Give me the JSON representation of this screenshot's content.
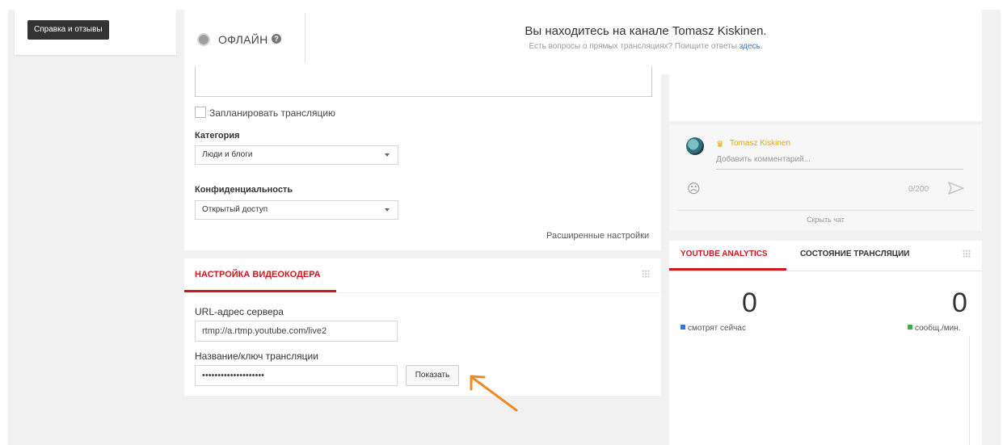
{
  "help": {
    "label": "Справка и отзывы"
  },
  "status": {
    "label": "ОФЛАЙН",
    "help_icon": "?"
  },
  "channel": {
    "title": "Вы находитесь на канале Tomasz Kiskinen.",
    "subtitle": "Есть вопросы о прямых трансляциях? Поищите ответы",
    "link": "здесь."
  },
  "settings": {
    "schedule_label": "Запланировать трансляцию",
    "category_label": "Категория",
    "category_value": "Люди и блоги",
    "privacy_label": "Конфиденциальность",
    "privacy_value": "Открытый доступ",
    "advanced_link": "Расширенные настройки"
  },
  "encoder": {
    "tab_label": "НАСТРОЙКА ВИДЕОКОДЕРА",
    "server_label": "URL-адрес сервера",
    "server_value": "rtmp://a.rtmp.youtube.com/live2",
    "key_label": "Название/ключ трансляции",
    "key_value": "••••••••••••••••••••",
    "show_button": "Показать"
  },
  "chat": {
    "author": "Tomasz Kiskinen",
    "placeholder": "Добавить комментарий...",
    "char_count": "0/200",
    "hide_label": "Скрыть чат"
  },
  "analytics": {
    "tab_analytics": "YOUTUBE ANALYTICS",
    "tab_state": "СОСТОЯНИЕ ТРАНСЛЯЦИИ",
    "viewers_value": "0",
    "viewers_label": "смотрят сейчас",
    "messages_value": "0",
    "messages_label": "сообщ./мин."
  },
  "colors": {
    "accent_red": "#cc181e",
    "viewers_blue": "#2e7bd6",
    "messages_green": "#3cb043",
    "arrow_orange": "#f08a24",
    "author_gold": "#e6a700"
  }
}
